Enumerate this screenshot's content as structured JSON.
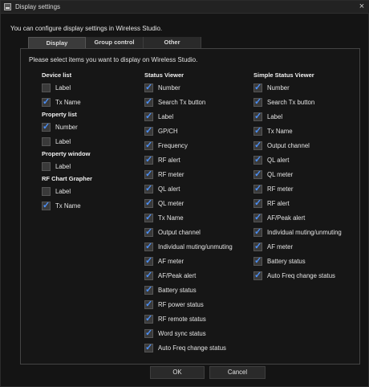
{
  "window": {
    "title": "Display settings"
  },
  "icons": {
    "app": "app-icon",
    "close": "close-icon"
  },
  "close_glyph": "×",
  "intro": "You can configure display settings in Wireless Studio.",
  "tabs": [
    {
      "label": "Display",
      "active": true
    },
    {
      "label": "Group control",
      "active": false
    },
    {
      "label": "Other",
      "active": false
    }
  ],
  "instruction": "Please select items you want to display on Wireless Studio.",
  "device_list": {
    "title": "Device list",
    "items": [
      {
        "label": "Label",
        "checked": false
      },
      {
        "label": "Tx Name",
        "checked": true
      }
    ]
  },
  "property_list": {
    "title": "Property list",
    "items": [
      {
        "label": "Number",
        "checked": true
      },
      {
        "label": "Label",
        "checked": false
      }
    ]
  },
  "property_window": {
    "title": "Property window",
    "items": [
      {
        "label": "Label",
        "checked": false
      }
    ]
  },
  "rf_chart_grapher": {
    "title": "RF Chart Grapher",
    "items": [
      {
        "label": "Label",
        "checked": false
      },
      {
        "label": "Tx Name",
        "checked": true
      }
    ]
  },
  "status_viewer": {
    "title": "Status Viewer",
    "items": [
      {
        "label": "Number",
        "checked": true
      },
      {
        "label": "Search Tx button",
        "checked": true
      },
      {
        "label": "Label",
        "checked": true
      },
      {
        "label": "GP/CH",
        "checked": true
      },
      {
        "label": "Frequency",
        "checked": true
      },
      {
        "label": "RF alert",
        "checked": true
      },
      {
        "label": "RF meter",
        "checked": true
      },
      {
        "label": "QL alert",
        "checked": true
      },
      {
        "label": "QL meter",
        "checked": true
      },
      {
        "label": "Tx Name",
        "checked": true
      },
      {
        "label": "Output channel",
        "checked": true
      },
      {
        "label": "Individual muting/unmuting",
        "checked": true
      },
      {
        "label": "AF meter",
        "checked": true
      },
      {
        "label": "AF/Peak alert",
        "checked": true
      },
      {
        "label": "Battery status",
        "checked": true
      },
      {
        "label": "RF power status",
        "checked": true
      },
      {
        "label": "RF remote status",
        "checked": true
      },
      {
        "label": "Word sync status",
        "checked": true
      },
      {
        "label": "Auto Freq change status",
        "checked": true
      }
    ]
  },
  "simple_status_viewer": {
    "title": "Simple Status Viewer",
    "items": [
      {
        "label": "Number",
        "checked": true
      },
      {
        "label": "Search Tx button",
        "checked": true
      },
      {
        "label": "Label",
        "checked": true
      },
      {
        "label": "Tx Name",
        "checked": true
      },
      {
        "label": "Output channel",
        "checked": true
      },
      {
        "label": "QL alert",
        "checked": true
      },
      {
        "label": "QL meter",
        "checked": true
      },
      {
        "label": "RF meter",
        "checked": true
      },
      {
        "label": "RF alert",
        "checked": true
      },
      {
        "label": "AF/Peak alert",
        "checked": true
      },
      {
        "label": "Individual muting/unmuting",
        "checked": true
      },
      {
        "label": "AF meter",
        "checked": true
      },
      {
        "label": "Battery status",
        "checked": true
      },
      {
        "label": "Auto Freq change status",
        "checked": true
      }
    ]
  },
  "buttons": {
    "ok": "OK",
    "cancel": "Cancel"
  },
  "colors": {
    "check": "#4c8ff5",
    "background": "#141414",
    "panel_border": "#444444"
  }
}
